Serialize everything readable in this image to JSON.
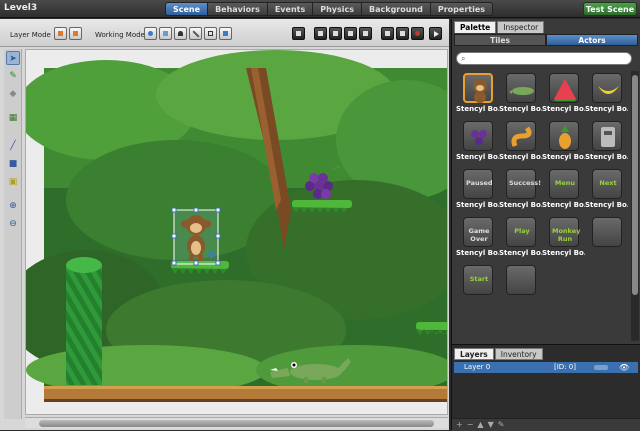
{
  "app": {
    "title": "Level3"
  },
  "tabs": [
    {
      "label": "Scene",
      "active": true
    },
    {
      "label": "Behaviors"
    },
    {
      "label": "Events"
    },
    {
      "label": "Physics"
    },
    {
      "label": "Background"
    },
    {
      "label": "Properties"
    }
  ],
  "test_button": "Test Scene",
  "toolbar": {
    "layer_mode": "Layer Mode",
    "working_mode": "Working Mode"
  },
  "palette": {
    "tabs": [
      "Palette",
      "Inspector"
    ],
    "subtabs": [
      "Tiles",
      "Actors"
    ],
    "search_placeholder": "",
    "actors": [
      {
        "name": "Stencyl Bo...",
        "icon": "monkey-icon",
        "selected": true
      },
      {
        "name": "Stencyl Bo...",
        "icon": "crocodile-icon"
      },
      {
        "name": "Stencyl Bo...",
        "icon": "watermelon-icon"
      },
      {
        "name": "Stencyl Bo...",
        "icon": "banana-icon"
      },
      {
        "name": "Stencyl Bo...",
        "icon": "grapes-icon"
      },
      {
        "name": "Stencyl Bo...",
        "icon": "snake-icon"
      },
      {
        "name": "Stencyl Bo...",
        "icon": "pineapple-icon"
      },
      {
        "name": "Stencyl Bo...",
        "icon": "robot-icon"
      },
      {
        "name": "Stencyl Bo...",
        "icon": "paused-button",
        "text": "Paused"
      },
      {
        "name": "Stencyl Bo...",
        "icon": "success-button",
        "text": "Success!"
      },
      {
        "name": "Stencyl Bo...",
        "icon": "menu-button",
        "text": "Menu"
      },
      {
        "name": "Stencyl Bo...",
        "icon": "next-button",
        "text": "Next"
      },
      {
        "name": "Stencyl Bo...",
        "icon": "game-over-button",
        "text": "Game Over"
      },
      {
        "name": "Stencyl Bo...",
        "icon": "play-button",
        "text": "Play"
      },
      {
        "name": "Stencyl Bo...",
        "icon": "monkey-run-button",
        "text": "Monkey Run"
      },
      {
        "name": "",
        "icon": "banner-icon",
        "text": ""
      },
      {
        "name": "",
        "icon": "start-button",
        "text": "Start"
      },
      {
        "name": "",
        "icon": "credits-icon",
        "text": ""
      }
    ]
  },
  "layers": {
    "tabs": [
      "Layers",
      "Inventory"
    ],
    "items": [
      {
        "name": "Layer 0",
        "id": "[ID: 0]"
      }
    ]
  },
  "colors": {
    "accent": "#3a6fb0",
    "test_green": "#3c8c3c"
  }
}
